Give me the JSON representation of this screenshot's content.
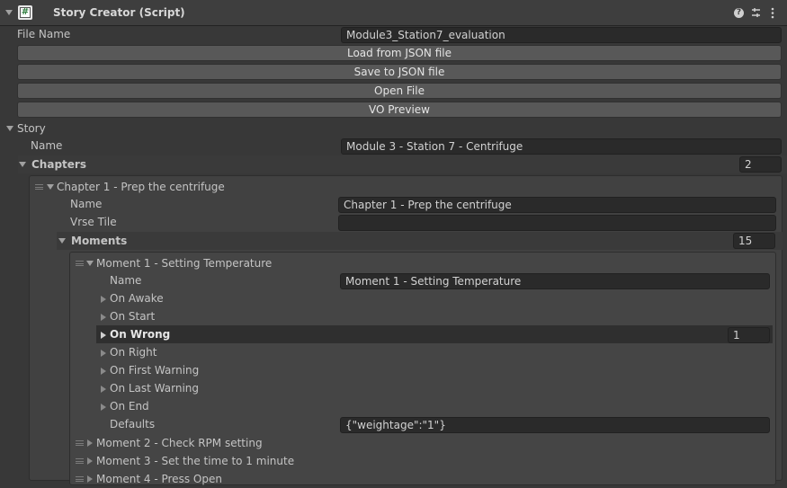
{
  "header": {
    "title": "Story Creator (Script)",
    "icons": [
      "help-icon",
      "preset-icon",
      "kebab-menu-icon"
    ],
    "script_icon_glyph": "#"
  },
  "file": {
    "label": "File Name",
    "value": "Module3_Station7_evaluation"
  },
  "buttons": {
    "load": "Load from JSON file",
    "save": "Save to JSON file",
    "open": "Open File",
    "vo": "VO Preview"
  },
  "story": {
    "label": "Story",
    "name_label": "Name",
    "name_value": "Module 3 - Station 7 - Centrifuge",
    "chapters_label": "Chapters",
    "chapters_count": "2",
    "chapter1": {
      "title": "Chapter 1 - Prep the centrifuge",
      "name_label": "Name",
      "name_value": "Chapter 1 - Prep the centrifuge",
      "tile_label": "Vrse Tile",
      "tile_value": "",
      "moments_label": "Moments",
      "moments_count": "15",
      "moment1": {
        "title": "Moment 1 - Setting Temperature",
        "name_label": "Name",
        "name_value": "Moment 1 - Setting Temperature",
        "events": {
          "on_awake": "On Awake",
          "on_start": "On Start",
          "on_wrong": "On Wrong",
          "on_wrong_count": "1",
          "on_right": "On Right",
          "on_first_warning": "On First Warning",
          "on_last_warning": "On Last Warning",
          "on_end": "On End"
        },
        "defaults_label": "Defaults",
        "defaults_value": "{\"weightage\":\"1\"}"
      },
      "moment2": "Moment 2 - Check RPM setting",
      "moment3": "Moment 3 - Set the time to 1 minute",
      "moment4": "Moment 4 - Press Open"
    }
  },
  "colors": {
    "background": "#383838",
    "header": "#3e3e3e",
    "field": "#2a2a2a",
    "button": "#585858",
    "highlight_row": "#2f2f2f"
  }
}
